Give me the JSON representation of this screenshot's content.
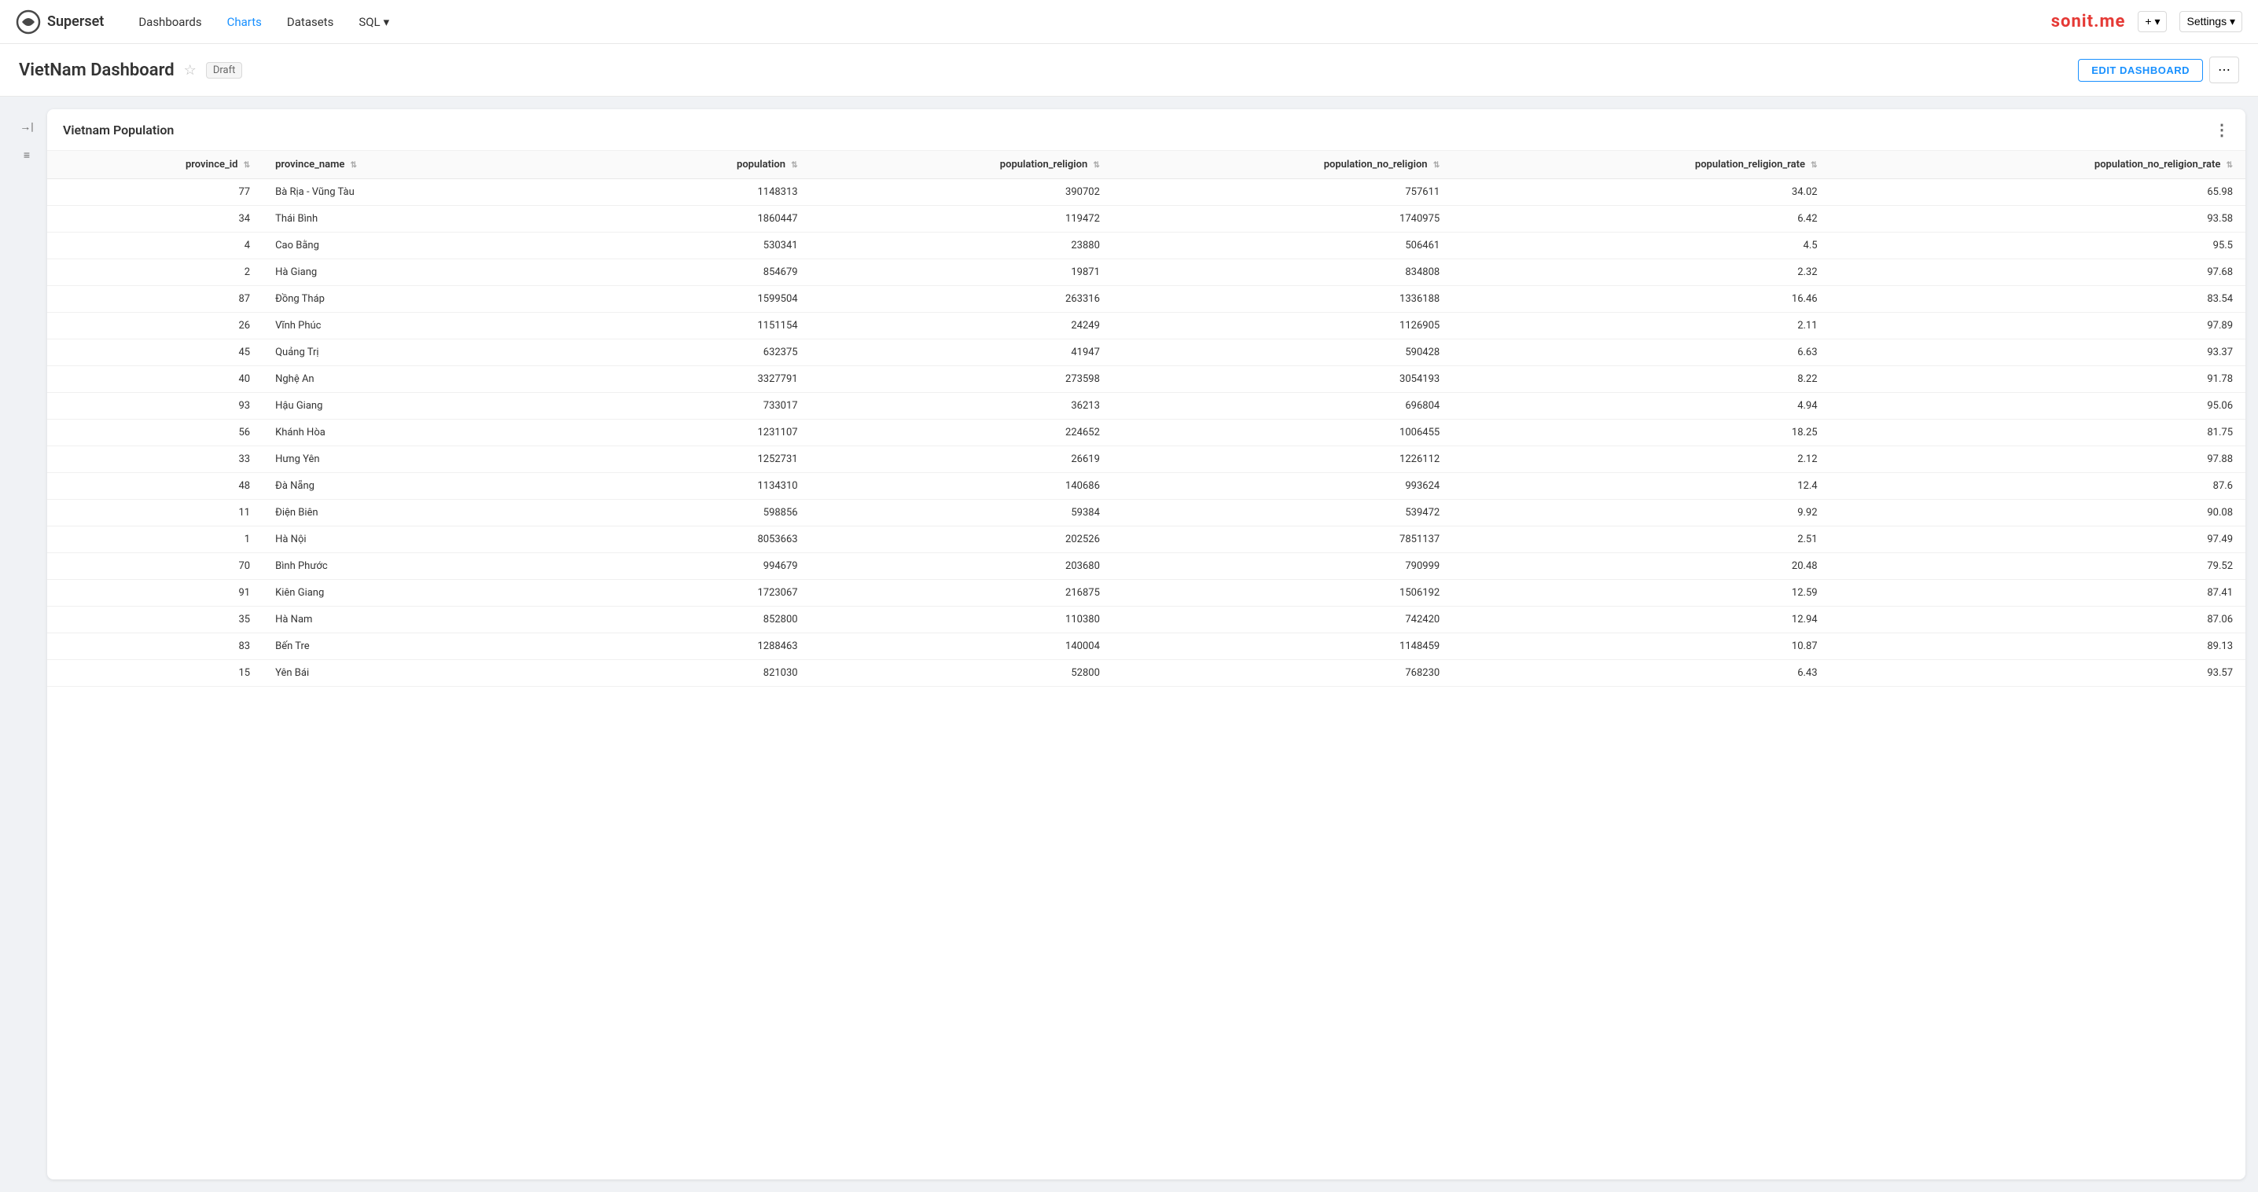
{
  "navbar": {
    "logo_text": "Superset",
    "nav_items": [
      {
        "label": "Dashboards",
        "active": false
      },
      {
        "label": "Charts",
        "active": true
      },
      {
        "label": "Datasets",
        "active": false
      },
      {
        "label": "SQL",
        "active": false,
        "has_dropdown": true
      }
    ],
    "brand": "sonit.me",
    "add_btn_label": "+ ▾",
    "settings_btn_label": "Settings ▾"
  },
  "dashboard_header": {
    "title": "VietNam Dashboard",
    "star_icon": "☆",
    "draft_label": "Draft",
    "edit_btn_label": "EDIT DASHBOARD",
    "more_icon": "⋯"
  },
  "sidebar": {
    "collapse_icon": "→|",
    "filter_icon": "≡"
  },
  "table_card": {
    "title": "Vietnam Population",
    "more_icon": "⋮",
    "columns": [
      {
        "key": "province_id",
        "label": "province_id",
        "align": "right"
      },
      {
        "key": "province_name",
        "label": "province_name",
        "align": "left"
      },
      {
        "key": "population",
        "label": "population",
        "align": "right"
      },
      {
        "key": "population_religion",
        "label": "population_religion",
        "align": "right"
      },
      {
        "key": "population_no_religion",
        "label": "population_no_religion",
        "align": "right"
      },
      {
        "key": "population_religion_rate",
        "label": "population_religion_rate",
        "align": "right"
      },
      {
        "key": "population_no_religion_rate",
        "label": "population_no_religion_rate",
        "align": "right"
      }
    ],
    "rows": [
      {
        "province_id": "77",
        "province_name": "Bà Rịa - Vũng Tàu",
        "population": "1148313",
        "population_religion": "390702",
        "population_no_religion": "757611",
        "population_religion_rate": "34.02",
        "population_no_religion_rate": "65.98"
      },
      {
        "province_id": "34",
        "province_name": "Thái Bình",
        "population": "1860447",
        "population_religion": "119472",
        "population_no_religion": "1740975",
        "population_religion_rate": "6.42",
        "population_no_religion_rate": "93.58"
      },
      {
        "province_id": "4",
        "province_name": "Cao Bằng",
        "population": "530341",
        "population_religion": "23880",
        "population_no_religion": "506461",
        "population_religion_rate": "4.5",
        "population_no_religion_rate": "95.5"
      },
      {
        "province_id": "2",
        "province_name": "Hà Giang",
        "population": "854679",
        "population_religion": "19871",
        "population_no_religion": "834808",
        "population_religion_rate": "2.32",
        "population_no_religion_rate": "97.68"
      },
      {
        "province_id": "87",
        "province_name": "Đồng Tháp",
        "population": "1599504",
        "population_religion": "263316",
        "population_no_religion": "1336188",
        "population_religion_rate": "16.46",
        "population_no_religion_rate": "83.54"
      },
      {
        "province_id": "26",
        "province_name": "Vĩnh Phúc",
        "population": "1151154",
        "population_religion": "24249",
        "population_no_religion": "1126905",
        "population_religion_rate": "2.11",
        "population_no_religion_rate": "97.89"
      },
      {
        "province_id": "45",
        "province_name": "Quảng Trị",
        "population": "632375",
        "population_religion": "41947",
        "population_no_religion": "590428",
        "population_religion_rate": "6.63",
        "population_no_religion_rate": "93.37"
      },
      {
        "province_id": "40",
        "province_name": "Nghệ An",
        "population": "3327791",
        "population_religion": "273598",
        "population_no_religion": "3054193",
        "population_religion_rate": "8.22",
        "population_no_religion_rate": "91.78"
      },
      {
        "province_id": "93",
        "province_name": "Hậu Giang",
        "population": "733017",
        "population_religion": "36213",
        "population_no_religion": "696804",
        "population_religion_rate": "4.94",
        "population_no_religion_rate": "95.06"
      },
      {
        "province_id": "56",
        "province_name": "Khánh Hòa",
        "population": "1231107",
        "population_religion": "224652",
        "population_no_religion": "1006455",
        "population_religion_rate": "18.25",
        "population_no_religion_rate": "81.75"
      },
      {
        "province_id": "33",
        "province_name": "Hưng Yên",
        "population": "1252731",
        "population_religion": "26619",
        "population_no_religion": "1226112",
        "population_religion_rate": "2.12",
        "population_no_religion_rate": "97.88"
      },
      {
        "province_id": "48",
        "province_name": "Đà Nẵng",
        "population": "1134310",
        "population_religion": "140686",
        "population_no_religion": "993624",
        "population_religion_rate": "12.4",
        "population_no_religion_rate": "87.6"
      },
      {
        "province_id": "11",
        "province_name": "Điện Biên",
        "population": "598856",
        "population_religion": "59384",
        "population_no_religion": "539472",
        "population_religion_rate": "9.92",
        "population_no_religion_rate": "90.08"
      },
      {
        "province_id": "1",
        "province_name": "Hà Nội",
        "population": "8053663",
        "population_religion": "202526",
        "population_no_religion": "7851137",
        "population_religion_rate": "2.51",
        "population_no_religion_rate": "97.49"
      },
      {
        "province_id": "70",
        "province_name": "Bình Phước",
        "population": "994679",
        "population_religion": "203680",
        "population_no_religion": "790999",
        "population_religion_rate": "20.48",
        "population_no_religion_rate": "79.52"
      },
      {
        "province_id": "91",
        "province_name": "Kiên Giang",
        "population": "1723067",
        "population_religion": "216875",
        "population_no_religion": "1506192",
        "population_religion_rate": "12.59",
        "population_no_religion_rate": "87.41"
      },
      {
        "province_id": "35",
        "province_name": "Hà Nam",
        "population": "852800",
        "population_religion": "110380",
        "population_no_religion": "742420",
        "population_religion_rate": "12.94",
        "population_no_religion_rate": "87.06"
      },
      {
        "province_id": "83",
        "province_name": "Bến Tre",
        "population": "1288463",
        "population_religion": "140004",
        "population_no_religion": "1148459",
        "population_religion_rate": "10.87",
        "population_no_religion_rate": "89.13"
      },
      {
        "province_id": "15",
        "province_name": "Yên Bái",
        "population": "821030",
        "population_religion": "52800",
        "population_no_religion": "768230",
        "population_religion_rate": "6.43",
        "population_no_religion_rate": "93.57"
      }
    ]
  }
}
